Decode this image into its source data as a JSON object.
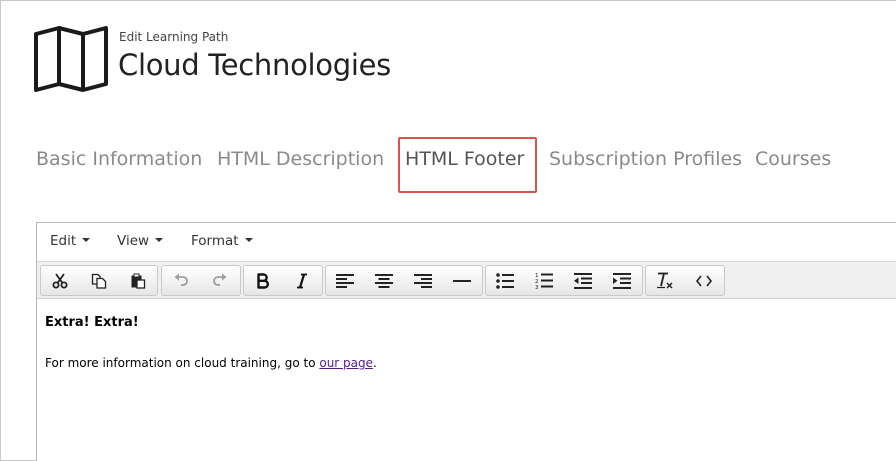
{
  "header": {
    "subtitle": "Edit Learning Path",
    "title": "Cloud Technologies"
  },
  "tabs": [
    {
      "label": "Basic Information",
      "active": false
    },
    {
      "label": "HTML Description",
      "active": false
    },
    {
      "label": "HTML Footer",
      "active": true
    },
    {
      "label": "Subscription Profiles",
      "active": false
    },
    {
      "label": "Courses",
      "active": false
    }
  ],
  "highlight_color": "#d9534f",
  "editor": {
    "menu": [
      "Edit",
      "View",
      "Format"
    ],
    "toolbar_icons": [
      "cut-icon",
      "copy-icon",
      "paste-icon",
      "undo-icon",
      "redo-icon",
      "bold-icon",
      "italic-icon",
      "align-left-icon",
      "align-center-icon",
      "align-right-icon",
      "horizontal-rule-icon",
      "bullet-list-icon",
      "numbered-list-icon",
      "outdent-icon",
      "indent-icon",
      "clear-formatting-icon",
      "source-code-icon"
    ],
    "content": {
      "headline": "Extra! Extra!",
      "paragraph_text": "For more information on cloud training, go to ",
      "link_text": "our page",
      "paragraph_end": "."
    }
  }
}
